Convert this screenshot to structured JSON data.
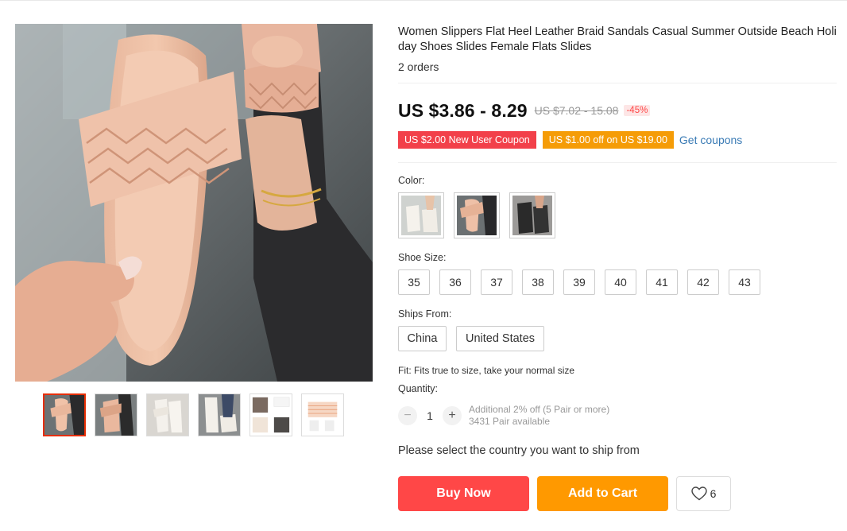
{
  "product": {
    "title": "Women Slippers Flat Heel Leather Braid Sandals Casual Summer Outside Beach Holi day Shoes Slides Female Flats Slides",
    "orders": "2 orders"
  },
  "price": {
    "current": "US $3.86 - 8.29",
    "original": "US $7.02 - 15.08",
    "discount": "-45%"
  },
  "coupons": {
    "new_user": "US $2.00 New User Coupon",
    "store": "US $1.00 off on US $19.00",
    "get_coupons": "Get coupons"
  },
  "color": {
    "label": "Color:",
    "swatch_icons": [
      "white-sandal-photo",
      "pink-sandal-photo",
      "black-sandal-photo"
    ]
  },
  "shoe_size": {
    "label": "Shoe Size:",
    "options": [
      "35",
      "36",
      "37",
      "38",
      "39",
      "40",
      "41",
      "42",
      "43"
    ]
  },
  "ships_from": {
    "label": "Ships From:",
    "options": [
      "China",
      "United States"
    ]
  },
  "fit": "Fit: Fits true to size, take your normal size",
  "quantity": {
    "label": "Quantity:",
    "minus": "−",
    "plus": "+",
    "value": "1",
    "note_discount": "Additional 2% off (5 Pair or more)",
    "note_available": "3431 Pair available"
  },
  "ship_prompt": "Please select the country you want to ship from",
  "actions": {
    "buy_now": "Buy Now",
    "add_to_cart": "Add to Cart",
    "wishlist_count": "6"
  },
  "gallery": {
    "thumbnail_icons": [
      "pink-slide-photo",
      "pink-slide-worn-photo",
      "white-slide-photo",
      "white-slide-worn-photo",
      "black-slide-photo",
      "size-chart-image"
    ]
  },
  "colors": {
    "price": "#111111",
    "coupon_red": "#f2404a",
    "coupon_orange": "#f59c07",
    "buy_now": "#ff4747",
    "add_to_cart": "#ff9900",
    "link": "#3a7bb5"
  }
}
